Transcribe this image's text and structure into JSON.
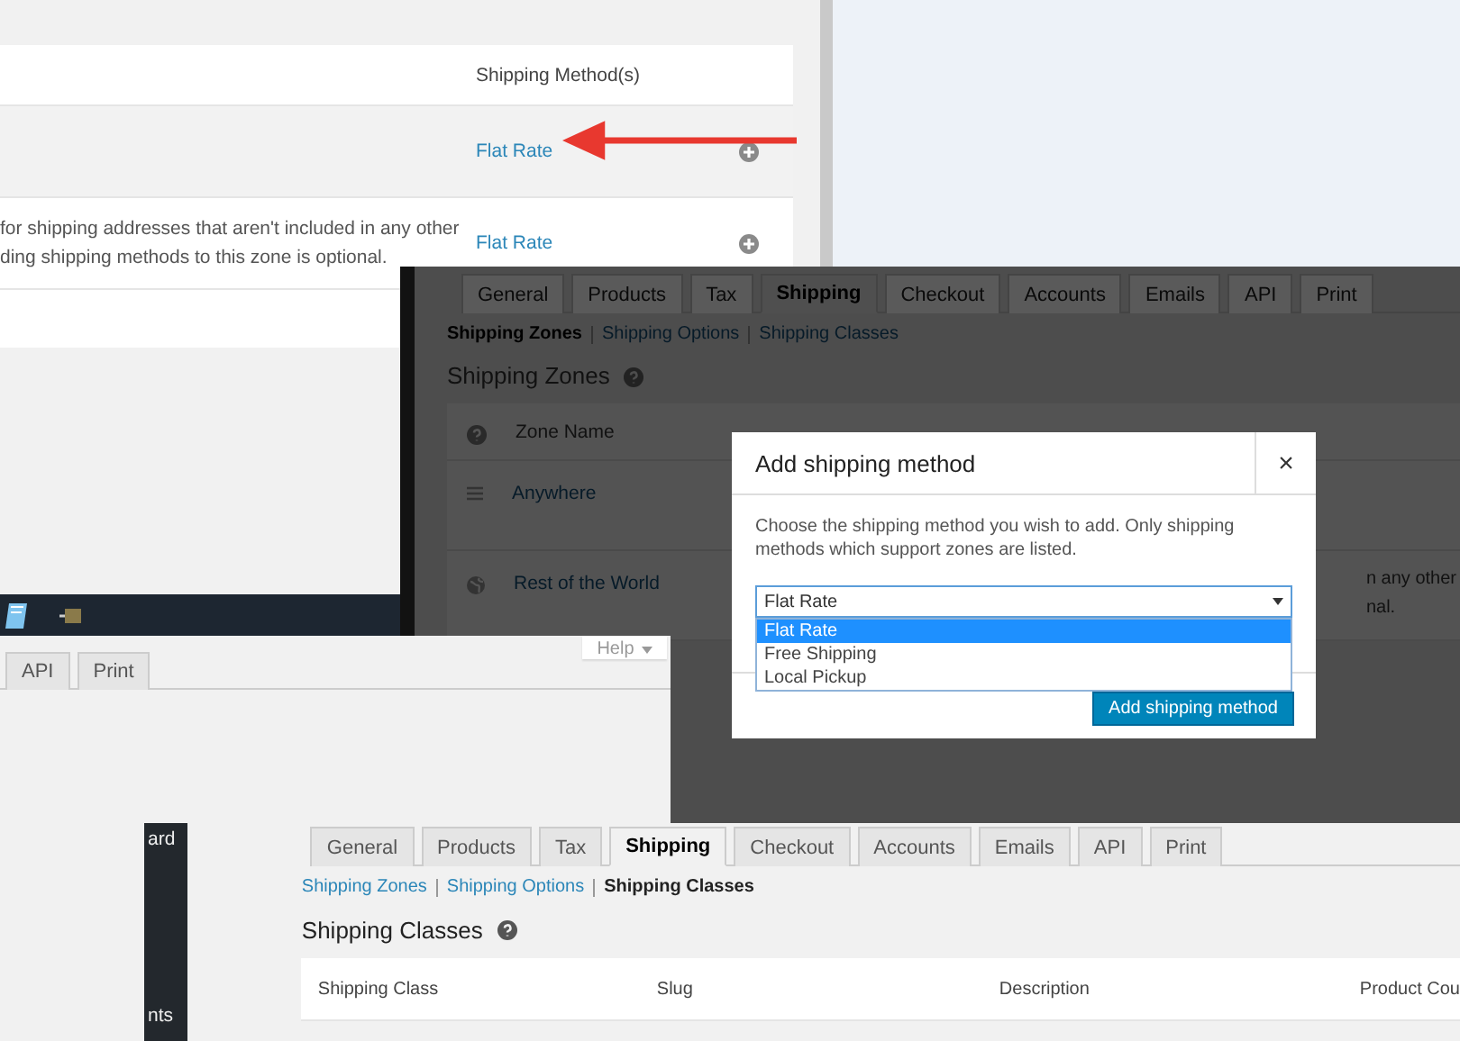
{
  "zones_window": {
    "table": {
      "columns": [
        "Shipping Method(s)"
      ],
      "rows": [
        {
          "highlighted": true,
          "method": "Flat Rate"
        },
        {
          "highlighted": false,
          "description_lines": [
            "for shipping addresses that aren't included in any other",
            "ding shipping methods to this zone is optional."
          ],
          "method": "Flat Rate"
        }
      ]
    }
  },
  "dimmed_window": {
    "tabs": [
      {
        "label": "General",
        "selected": false
      },
      {
        "label": "Products",
        "selected": false
      },
      {
        "label": "Tax",
        "selected": false
      },
      {
        "label": "Shipping",
        "selected": true
      },
      {
        "label": "Checkout",
        "selected": false
      },
      {
        "label": "Accounts",
        "selected": false
      },
      {
        "label": "Emails",
        "selected": false
      },
      {
        "label": "API",
        "selected": false
      },
      {
        "label": "Print",
        "selected": false
      }
    ],
    "sections": [
      {
        "label": "Shipping Zones",
        "selected": true
      },
      {
        "label": "Shipping Options",
        "selected": false
      },
      {
        "label": "Shipping Classes",
        "selected": false
      }
    ],
    "heading": "Shipping Zones",
    "table": {
      "columns": [
        "Zone Name"
      ],
      "rows": [
        {
          "kind": "drag",
          "name": "Anywhere"
        },
        {
          "kind": "world",
          "name": "Rest of the World",
          "description_lines": [
            "n any other",
            "nal."
          ]
        }
      ]
    }
  },
  "modal": {
    "title": "Add shipping method",
    "close_button": "×",
    "description": "Choose the shipping method you wish to add. Only shipping methods which support zones are listed.",
    "select": {
      "value": "Flat Rate",
      "options": [
        {
          "label": "Flat Rate",
          "selected": true
        },
        {
          "label": "Free Shipping",
          "selected": false
        },
        {
          "label": "Local Pickup",
          "selected": false
        }
      ]
    },
    "button": "Add shipping method"
  },
  "tabs_window": {
    "help_button": "Help",
    "tabs": [
      {
        "label": "API",
        "selected": false
      },
      {
        "label": "Print",
        "selected": false
      }
    ]
  },
  "classes_window": {
    "sidebar_items": [
      "ard",
      "nts"
    ],
    "tabs": [
      {
        "label": "General",
        "selected": false
      },
      {
        "label": "Products",
        "selected": false
      },
      {
        "label": "Tax",
        "selected": false
      },
      {
        "label": "Shipping",
        "selected": true
      },
      {
        "label": "Checkout",
        "selected": false
      },
      {
        "label": "Accounts",
        "selected": false
      },
      {
        "label": "Emails",
        "selected": false
      },
      {
        "label": "API",
        "selected": false
      },
      {
        "label": "Print",
        "selected": false
      }
    ],
    "sections": [
      {
        "label": "Shipping Zones",
        "selected": false
      },
      {
        "label": "Shipping Options",
        "selected": false
      },
      {
        "label": "Shipping Classes",
        "selected": true
      }
    ],
    "heading": "Shipping Classes",
    "table": {
      "columns": [
        "Shipping Class",
        "Slug",
        "Description",
        "Product Cou"
      ]
    }
  }
}
